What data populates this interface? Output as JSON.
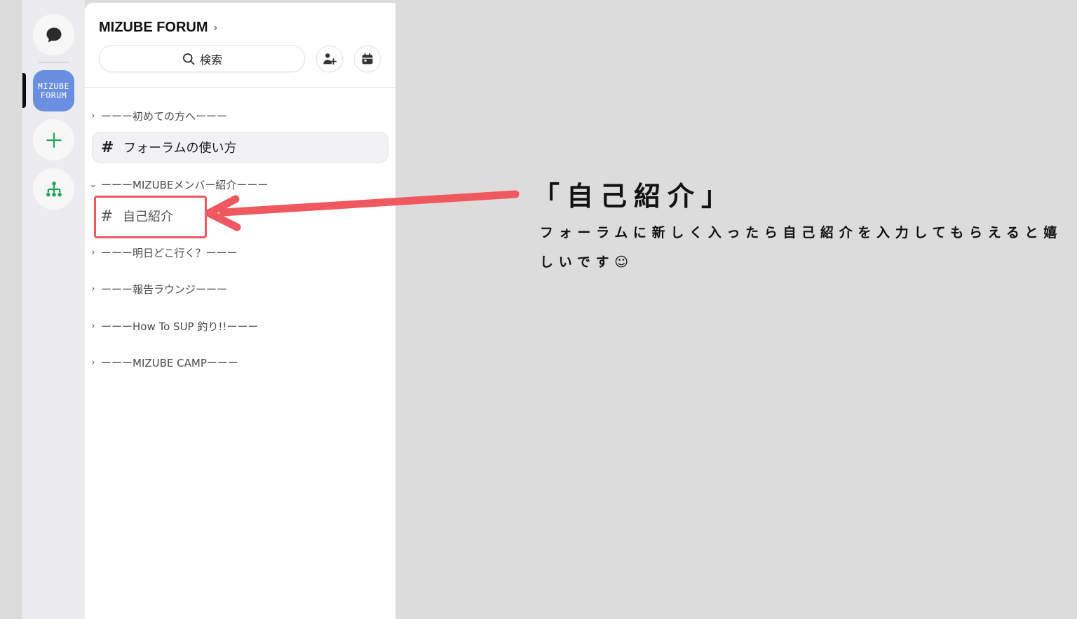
{
  "server": {
    "name": "MIZUBE FORUM",
    "badge_line1": "MIZUBE",
    "badge_line2": "FORUM"
  },
  "search": {
    "label": "検索"
  },
  "categories": [
    {
      "label": "ーーー初めての方へーーー",
      "expanded": false
    },
    {
      "label": "ーーーMIZUBEメンバー紹介ーーー",
      "expanded": true
    },
    {
      "label": "ーーー明日どこ行く？ーーー",
      "expanded": false
    },
    {
      "label": "ーーー報告ラウンジーーー",
      "expanded": false
    },
    {
      "label": "ーーーHow To SUP 釣り!!ーーー",
      "expanded": false
    },
    {
      "label": "ーーーMIZUBE CAMPーーー",
      "expanded": false
    }
  ],
  "channels": [
    {
      "hash": "#",
      "name": "フォーラムの使い方"
    },
    {
      "hash": "#",
      "name": "自己紹介"
    }
  ],
  "annotation": {
    "title": "「自己紹介」",
    "body": "フォーラムに新しく入ったら自己紹介を入力してもらえると嬉しいです☺"
  },
  "colors": {
    "accent_server": "#6b8fe0",
    "highlight_red": "#f0585f",
    "plus_green": "#23a55a"
  },
  "icons": {
    "dm": "chat-bubble-icon",
    "add_server": "plus-icon",
    "discover": "hierarchy-icon",
    "search": "search-icon",
    "invite": "add-member-icon",
    "events": "calendar-icon"
  }
}
